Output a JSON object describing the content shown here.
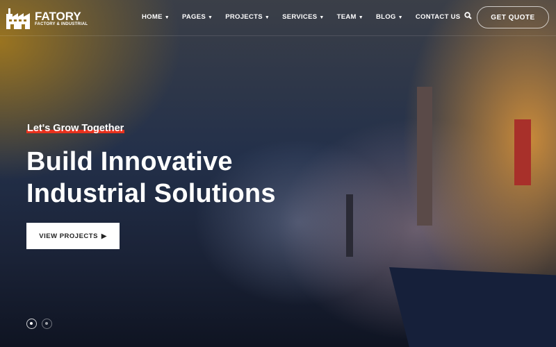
{
  "brand": {
    "name": "FATORY",
    "tagline": "FACTORY & INDUSTRIAL"
  },
  "nav": [
    {
      "label": "HOME",
      "dropdown": true
    },
    {
      "label": "PAGES",
      "dropdown": true
    },
    {
      "label": "PROJECTS",
      "dropdown": true
    },
    {
      "label": "SERVICES",
      "dropdown": true
    },
    {
      "label": "TEAM",
      "dropdown": true
    },
    {
      "label": "BLOG",
      "dropdown": true
    },
    {
      "label": "CONTACT US",
      "dropdown": false
    }
  ],
  "header": {
    "search_icon": "search-icon",
    "quote_label": "GET QUOTE"
  },
  "hero": {
    "tagline": "Let's Grow Together",
    "title_line1": "Build Innovative",
    "title_line2": "Industrial Solutions",
    "button_label": "VIEW PROJECTS",
    "button_icon": "caret-right-icon"
  },
  "slider": {
    "slides": 2,
    "active": 1
  },
  "colors": {
    "accent": "#e8321e",
    "button_bg": "#ffffff"
  }
}
